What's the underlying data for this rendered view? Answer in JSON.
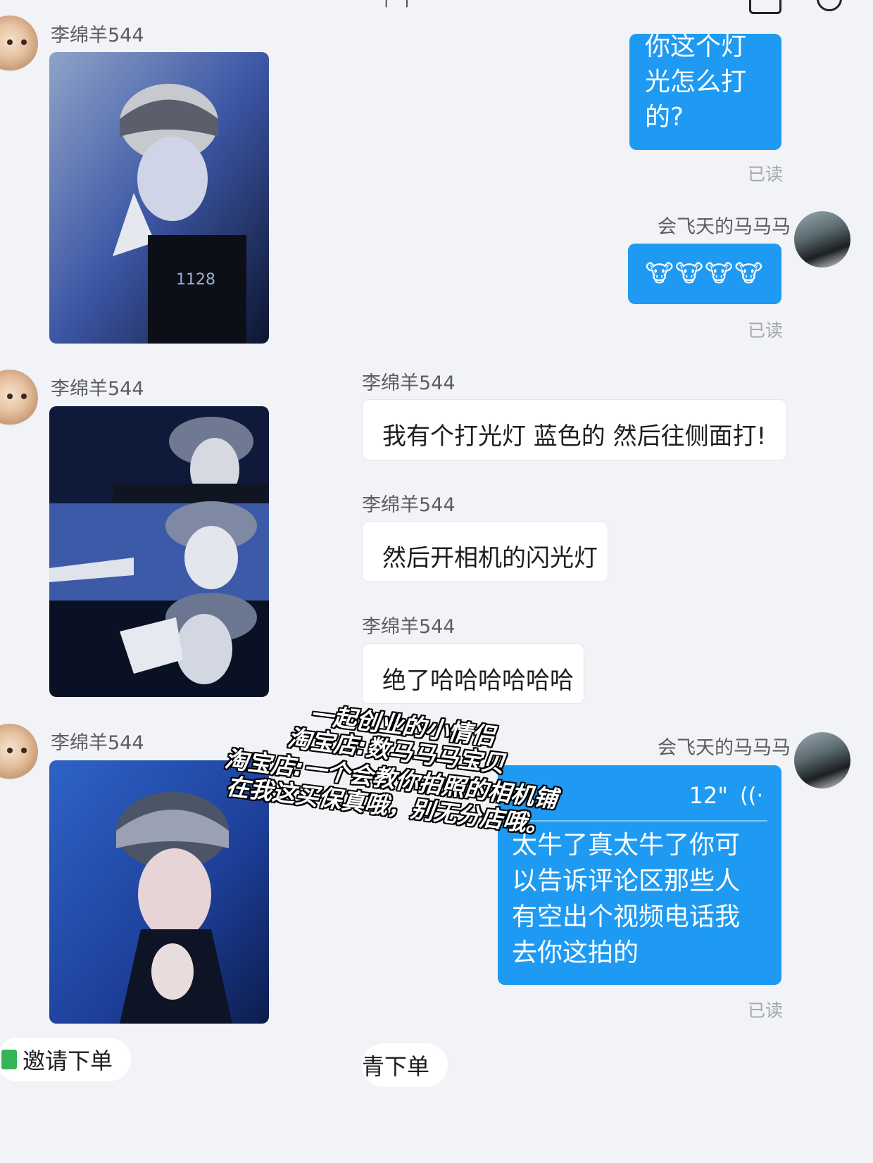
{
  "top_bar": {
    "partial_title": "- | - |",
    "partial_icon": "camera-icon"
  },
  "contact": {
    "name": "李绵羊544"
  },
  "me": {
    "name": "会飞天的马马马"
  },
  "messages": {
    "m1": {
      "text": "你这个灯光怎么打的?",
      "line1": "你这个灯",
      "line2": "光怎么打",
      "line3": "的?",
      "status": "已读"
    },
    "m2": {
      "emoji": "🐮🐮🐮🐮",
      "status": "已读"
    },
    "m3": {
      "text": "我有个打光灯 蓝色的 然后往侧面打!"
    },
    "m4": {
      "text": "然后开相机的闪光灯"
    },
    "m5": {
      "text": "绝了哈哈哈哈哈哈"
    },
    "m6": {
      "duration": "12\"",
      "transcript_lines": [
        "太牛了真太牛了你可",
        "以告诉评论区那些人",
        "有空出个视频电话我",
        "去你这拍的"
      ],
      "status": "已读"
    }
  },
  "overlay": {
    "lines": [
      "一起创业的小情侣",
      "淘宝店:数马马马宝贝",
      "淘宝店:一个会教你拍照的相机铺",
      "在我这买保真哦，别无分店哦。"
    ]
  },
  "invite": {
    "left_label": "邀请下单",
    "right_label": "青下单"
  },
  "colors": {
    "bubble_blue": "#1e9af2",
    "background": "#f2f3f7"
  }
}
